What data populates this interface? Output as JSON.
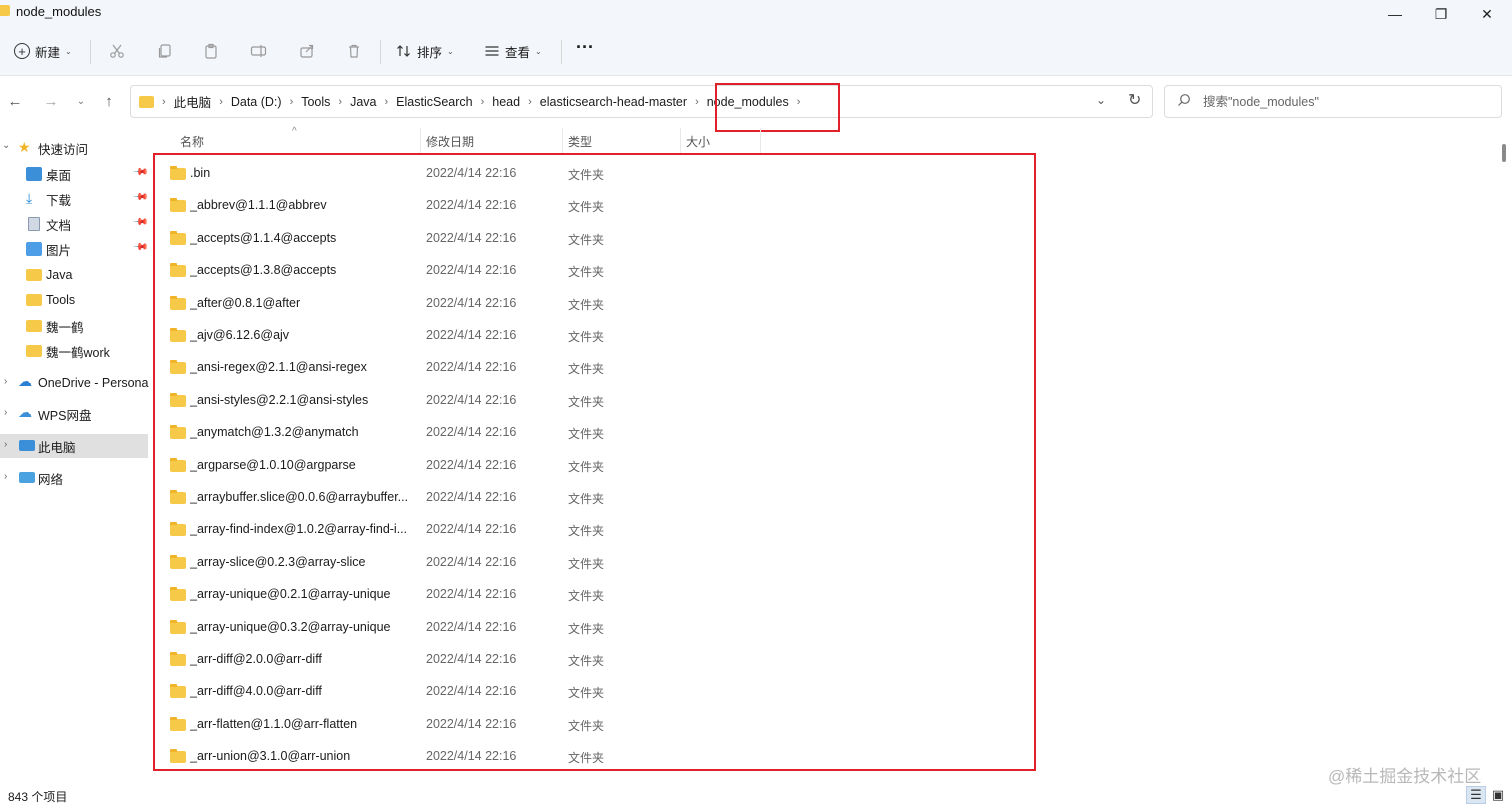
{
  "window": {
    "title": "node_modules",
    "minimize_glyph": "—",
    "maximize_glyph": "❐",
    "close_glyph": "✕"
  },
  "toolbar": {
    "new_label": "新建",
    "sort_label": "排序",
    "view_label": "查看",
    "more_glyph": "···"
  },
  "address": {
    "crumbs": [
      "此电脑",
      "Data (D:)",
      "Tools",
      "Java",
      "ElasticSearch",
      "head",
      "elasticsearch-head-master",
      "node_modules"
    ],
    "search_placeholder": "搜索\"node_modules\""
  },
  "sidebar": {
    "quick_access": "快速访问",
    "items": [
      "桌面",
      "下载",
      "文档",
      "图片",
      "Java",
      "Tools",
      "魏一鹤",
      "魏一鹤work"
    ],
    "onedrive": "OneDrive - Persona",
    "wps": "WPS网盘",
    "this_pc": "此电脑",
    "network": "网络"
  },
  "columns": {
    "name": "名称",
    "date": "修改日期",
    "type": "类型",
    "size": "大小"
  },
  "files": [
    {
      "name": ".bin",
      "date": "2022/4/14 22:16",
      "type": "文件夹"
    },
    {
      "name": "_abbrev@1.1.1@abbrev",
      "date": "2022/4/14 22:16",
      "type": "文件夹"
    },
    {
      "name": "_accepts@1.1.4@accepts",
      "date": "2022/4/14 22:16",
      "type": "文件夹"
    },
    {
      "name": "_accepts@1.3.8@accepts",
      "date": "2022/4/14 22:16",
      "type": "文件夹"
    },
    {
      "name": "_after@0.8.1@after",
      "date": "2022/4/14 22:16",
      "type": "文件夹"
    },
    {
      "name": "_ajv@6.12.6@ajv",
      "date": "2022/4/14 22:16",
      "type": "文件夹"
    },
    {
      "name": "_ansi-regex@2.1.1@ansi-regex",
      "date": "2022/4/14 22:16",
      "type": "文件夹"
    },
    {
      "name": "_ansi-styles@2.2.1@ansi-styles",
      "date": "2022/4/14 22:16",
      "type": "文件夹"
    },
    {
      "name": "_anymatch@1.3.2@anymatch",
      "date": "2022/4/14 22:16",
      "type": "文件夹"
    },
    {
      "name": "_argparse@1.0.10@argparse",
      "date": "2022/4/14 22:16",
      "type": "文件夹"
    },
    {
      "name": "_arraybuffer.slice@0.0.6@arraybuffer...",
      "date": "2022/4/14 22:16",
      "type": "文件夹"
    },
    {
      "name": "_array-find-index@1.0.2@array-find-i...",
      "date": "2022/4/14 22:16",
      "type": "文件夹"
    },
    {
      "name": "_array-slice@0.2.3@array-slice",
      "date": "2022/4/14 22:16",
      "type": "文件夹"
    },
    {
      "name": "_array-unique@0.2.1@array-unique",
      "date": "2022/4/14 22:16",
      "type": "文件夹"
    },
    {
      "name": "_array-unique@0.3.2@array-unique",
      "date": "2022/4/14 22:16",
      "type": "文件夹"
    },
    {
      "name": "_arr-diff@2.0.0@arr-diff",
      "date": "2022/4/14 22:16",
      "type": "文件夹"
    },
    {
      "name": "_arr-diff@4.0.0@arr-diff",
      "date": "2022/4/14 22:16",
      "type": "文件夹"
    },
    {
      "name": "_arr-flatten@1.1.0@arr-flatten",
      "date": "2022/4/14 22:16",
      "type": "文件夹"
    },
    {
      "name": "_arr-union@3.1.0@arr-union",
      "date": "2022/4/14 22:16",
      "type": "文件夹"
    }
  ],
  "status": {
    "item_count": "843 个项目"
  },
  "watermark": "@稀土掘金技术社区",
  "colors": {
    "highlight": "#e0202a",
    "folder": "#f7c948",
    "chrome_bg": "#f3f6fa"
  }
}
